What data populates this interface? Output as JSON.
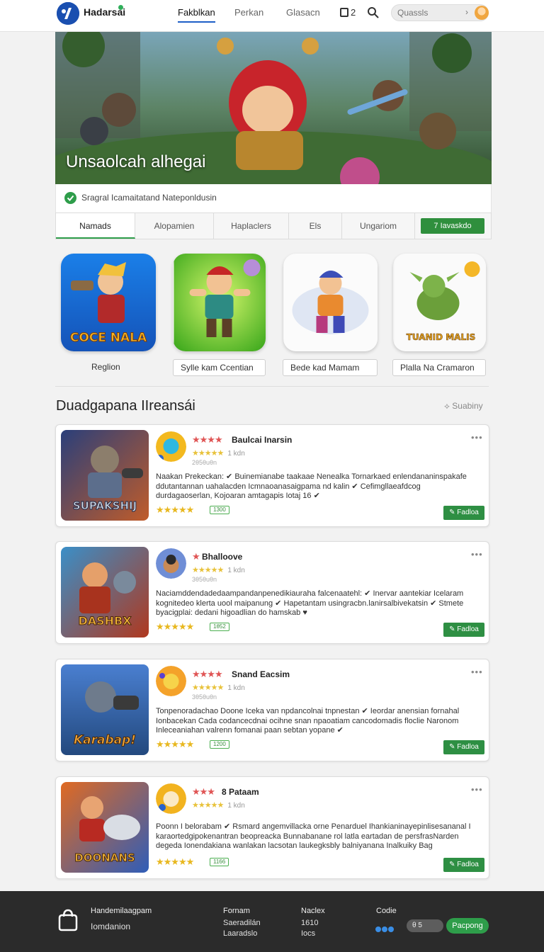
{
  "header": {
    "brand": "Hadarsai",
    "nav": [
      "Fakblkan",
      "Perkan",
      "Glasacn"
    ],
    "count": "2",
    "search_placeholder": "Quassls"
  },
  "hero": {
    "title": "Unsaolcah alhegai"
  },
  "notice": {
    "text": "Sragral Icamaitatand Nateponldusin"
  },
  "tabs": {
    "items": [
      "Namads",
      "Alopamien",
      "Haplaclers",
      "Els",
      "Ungariom"
    ],
    "action": "7 Iavaskdo"
  },
  "tiles": [
    {
      "caption": "Reglion",
      "art_label": "COCE NALA"
    },
    {
      "caption": "Sylle kam Ccentian",
      "art_label": ""
    },
    {
      "caption": "Bede kad Mamam",
      "art_label": ""
    },
    {
      "caption": "Plalla Na Cramaron",
      "art_label": "TUANID MALIS"
    }
  ],
  "section": {
    "title": "Duadgapana IIreansái",
    "action": "Suabiny"
  },
  "reviews": [
    {
      "name": "Baulcai Inarsin",
      "stars": "★★★★",
      "mini": "★★★★★",
      "count": "1 kdn",
      "date": "2θ5θuθn",
      "body": "Naakan Prekeckan: ✔ Buinemianabe taakaae Nenealka Tornarkaed enlendananinspakafe ddutantannan uahalacden Icmnaoanasaigpama nd kalin ✔ Cefimgllaeafdcog durdagaoserlan, Kojoaran amtagapis Iotaj 16 ✔",
      "rating": "★★★★★",
      "pill": "1300",
      "button": "✎ Fadloa",
      "thumb_label": "SUPAKSHIJ"
    },
    {
      "name": "Bhalloove",
      "stars": "★",
      "mini": "★★★★★",
      "count": "1 kdn",
      "date": "3θ5θuθn",
      "body": "Naciamddendadedaampandanpenedikiauraha falcenaatehl: ✔ Inervar aantekiar Icelaram kognitedeo klerta uool maipanung ✔ Hapetantam usingracbn.lanirsalbivekatsin ✔ Stmete byacigplai: dedani higoadlian do hamskab ♥",
      "rating": "★★★★★",
      "pill": "1θ52",
      "button": "✎ Fadloa",
      "thumb_label": "DASHBX"
    },
    {
      "name": "Snand Eacsim",
      "stars": "★★★★",
      "mini": "★★★★★",
      "count": "1 kdn",
      "date": "3θ5θuθn",
      "body": "Tonpenoradachao Doone Iceka van npdancolnai tnpnestan ✔ Ieordar anensian fornahal Ionbacekan Cada codancecdnai ocihne snan npaoatiam cancodomadis floclie Naronom Inleceaniahan valrenn fomanai paan sebtan yopane ✔",
      "rating": "★★★★★",
      "pill": "1200",
      "button": "✎ Fadloa",
      "thumb_label": "Karabap!"
    },
    {
      "name": "8 Pataam",
      "stars": "★★★",
      "mini": "★★★★★",
      "count": "1 kdn",
      "date": "",
      "body": "Poonn I belorabam ✔ Rsmard angemvillacka orne Penarduel Ihankianinayepinlisesananal I karaortedgipokenantran beopreacka Bunnabanane rol latla eartadan de persfrasNarden degeda Ionendakiana wanlakan lacsotan laukegksbly balniyanana Inalkuiky Bag",
      "rating": "★★★★★",
      "pill": "1166",
      "button": "✎ Fadloa",
      "thumb_label": "DOONANS"
    }
  ],
  "footer": {
    "col1": [
      "Handemilaagpam",
      "Iomdanion"
    ],
    "col2": [
      "Fornam",
      "Saeradilán",
      "Laaradslo"
    ],
    "col3": [
      "Naclex",
      "1610",
      "Iocs"
    ],
    "col4_head": "Codie",
    "toggle": "θ 5",
    "cta": "Pacpong"
  },
  "colors": {
    "accent_green": "#2e9d4a",
    "accent_blue": "#1d5fc7",
    "footer_bg": "#2b2b2b"
  }
}
